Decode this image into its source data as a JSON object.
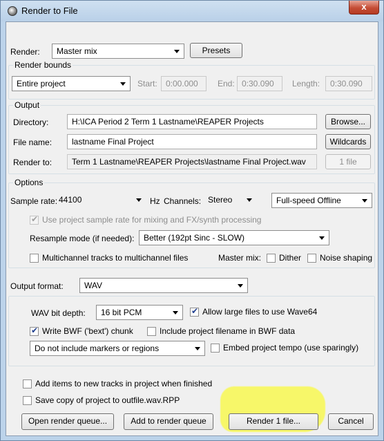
{
  "window": {
    "title": "Render to File",
    "close_label": "x"
  },
  "render": {
    "label": "Render:",
    "source": "Master mix",
    "presets_label": "Presets"
  },
  "bounds": {
    "group_title": "Render bounds",
    "selected": "Entire project",
    "start_label": "Start:",
    "start_value": "0:00.000",
    "end_label": "End:",
    "end_value": "0:30.090",
    "length_label": "Length:",
    "length_value": "0:30.090"
  },
  "output": {
    "group_title": "Output",
    "directory_label": "Directory:",
    "directory_value": "H:\\ICA Period 2 Term 1 Lastname\\REAPER Projects",
    "browse_label": "Browse...",
    "filename_label": "File name:",
    "filename_value": "lastname Final Project",
    "wildcards_label": "Wildcards",
    "renderto_label": "Render to:",
    "renderto_value": "Term 1 Lastname\\REAPER Projects\\lastname Final Project.wav",
    "files_count_label": "1 file"
  },
  "options": {
    "group_title": "Options",
    "sample_rate_label": "Sample rate:",
    "sample_rate_value": "44100",
    "hz_label": "Hz",
    "channels_label": "Channels:",
    "channels_value": "Stereo",
    "speed_value": "Full-speed Offline",
    "use_project_rate_label": "Use project sample rate for mixing and FX/synth processing",
    "use_project_rate_checked": true,
    "resample_label": "Resample mode (if needed):",
    "resample_value": "Better (192pt Sinc - SLOW)",
    "multichannel_label": "Multichannel tracks to multichannel files",
    "multichannel_checked": false,
    "master_mix_label": "Master mix:",
    "dither_label": "Dither",
    "dither_checked": false,
    "noise_shaping_label": "Noise shaping",
    "noise_shaping_checked": false
  },
  "format": {
    "label": "Output format:",
    "value": "WAV",
    "bit_depth_label": "WAV bit depth:",
    "bit_depth_value": "16 bit PCM",
    "large_files_label": "Allow large files to use Wave64",
    "large_files_checked": true,
    "bwf_label": "Write BWF ('bext') chunk",
    "bwf_checked": true,
    "include_filename_label": "Include project filename in BWF data",
    "include_filename_checked": false,
    "markers_value": "Do not include markers or regions",
    "embed_tempo_label": "Embed project tempo (use sparingly)",
    "embed_tempo_checked": false
  },
  "footer": {
    "add_items_label": "Add items to new tracks in project when finished",
    "add_items_checked": false,
    "save_copy_label": "Save copy of project to outfile.wav.RPP",
    "save_copy_checked": false,
    "open_queue_label": "Open render queue...",
    "add_queue_label": "Add to render queue",
    "render_label": "Render 1 file...",
    "cancel_label": "Cancel"
  },
  "colors": {
    "highlight": "#f5f53c",
    "titlebar": "#bcd3ea",
    "close": "#c54d35"
  }
}
